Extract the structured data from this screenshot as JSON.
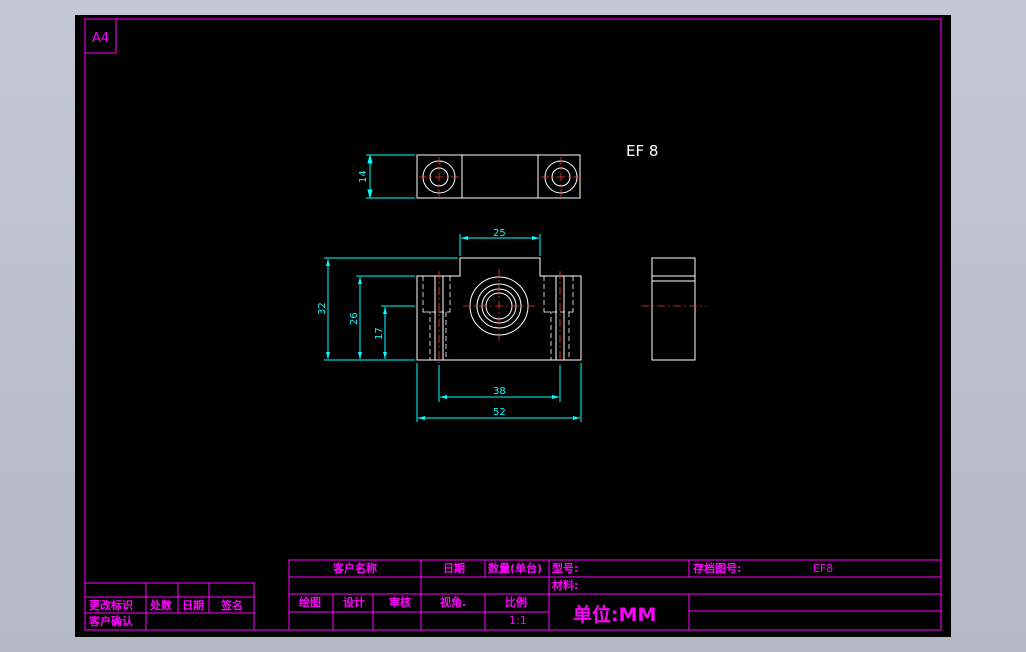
{
  "colors": {
    "frame": "#ff00ff",
    "dim": "#00ffff",
    "part": "#ffffff",
    "center": "#ff3333",
    "sheet": "#000000",
    "background": "#bcc1cc"
  },
  "sheet": {
    "size_label": "A4",
    "part_title": "EF 8"
  },
  "dimensions": {
    "top_view_height": "14",
    "front_top_width": "25",
    "total_height": "32",
    "mid_height": "26",
    "center_height": "17",
    "bolt_spacing": "38",
    "total_width": "52"
  },
  "title_block": {
    "customer_name": "客户名称",
    "date": "日期",
    "quantity": "数量(单台)",
    "model": "型号:",
    "drawing_no_label": "存档图号:",
    "drawing_no": "EF8",
    "material": "材料:",
    "drawn": "绘图",
    "design": "设计",
    "review": "审核",
    "view_angle": "视角.",
    "scale_label": "比例",
    "scale": "1:1",
    "unit": "单位:MM"
  },
  "revision_block": {
    "change_mark": "更改标识",
    "location": "处数",
    "date": "日期",
    "signature": "签名",
    "customer_confirm": "客户确认"
  }
}
